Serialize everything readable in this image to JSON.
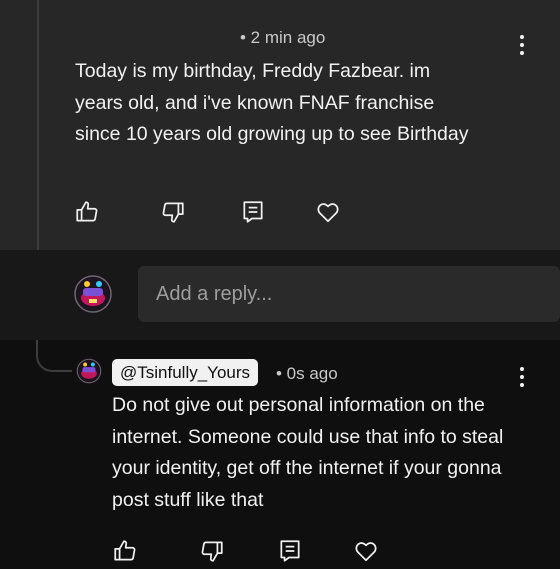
{
  "top_comment": {
    "meta": "• 2 min ago",
    "text": "Today is my birthday, Freddy Fazbear. im\nyears old, and i've known FNAF franchise\nsince 10 years old growing up to see Birthday",
    "icons": [
      "like-icon",
      "dislike-icon",
      "reply-icon",
      "heart-icon"
    ]
  },
  "reply_box": {
    "placeholder": "Add a reply..."
  },
  "reply_comment": {
    "mention": "@Tsinfully_Yours",
    "meta": "• 0s ago",
    "text": "Do not give out personal information on the internet. Someone could use that info to steal your identity, get off the internet if your gonna post stuff like that",
    "icons": [
      "like-icon",
      "dislike-icon",
      "reply-icon",
      "heart-icon"
    ]
  },
  "colors": {
    "background": "#0f0f0f",
    "card": "#272727",
    "input": "#2a2a2a",
    "text": "#f1f1f1",
    "muted": "#9e9e9e"
  }
}
